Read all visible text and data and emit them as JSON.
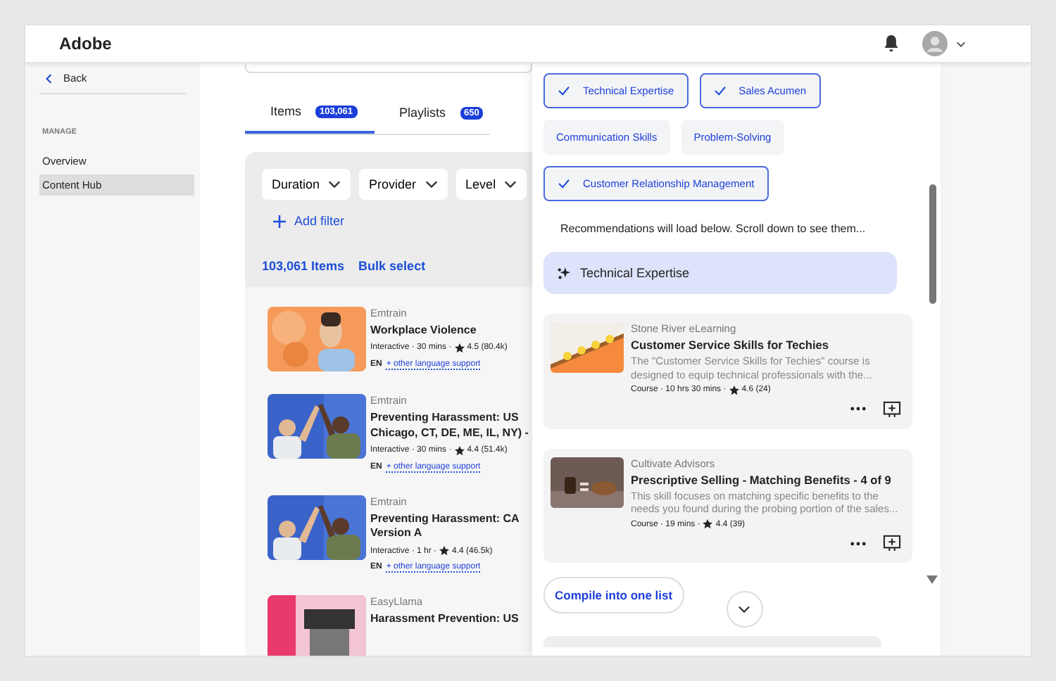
{
  "header": {
    "logo": "Adobe"
  },
  "sidebar": {
    "back": "Back",
    "section": "MANAGE",
    "items": [
      {
        "label": "Overview",
        "selected": false
      },
      {
        "label": "Content Hub",
        "selected": true
      }
    ]
  },
  "tabs": [
    {
      "label": "Items",
      "count": "103,061",
      "selected": true
    },
    {
      "label": "Playlists",
      "count": "650",
      "selected": false
    }
  ],
  "filters": [
    "Duration",
    "Provider",
    "Level"
  ],
  "add_filter": "Add filter",
  "item_count": "103,061 Items",
  "bulk_select": "Bulk select",
  "items": [
    {
      "provider": "Emtrain",
      "title": "Workplace Violence",
      "meta": "Interactive · 30 mins ·",
      "rating": "4.5 (80.4k)",
      "lang": "EN",
      "lang_link": "+ other language support"
    },
    {
      "provider": "Emtrain",
      "title": "Preventing Harassment: US Chicago, CT, DE, ME, IL, NY) -",
      "meta": "Interactive · 30 mins ·",
      "rating": "4.4 (51.4k)",
      "lang": "EN",
      "lang_link": "+ other language support"
    },
    {
      "provider": "Emtrain",
      "title": "Preventing Harassment: CA Version A",
      "meta": "Interactive · 1 hr ·",
      "rating": "4.4 (46.5k)",
      "lang": "EN",
      "lang_link": "+ other language support"
    },
    {
      "provider": "EasyLlama",
      "title": "Harassment Prevention: US"
    }
  ],
  "panel": {
    "skills": [
      {
        "label": "Technical Expertise",
        "selected": true
      },
      {
        "label": "Sales Acumen",
        "selected": true
      },
      {
        "label": "Communication Skills",
        "selected": false
      },
      {
        "label": "Problem-Solving",
        "selected": false
      },
      {
        "label": "Customer Relationship Management",
        "selected": true
      }
    ],
    "notice": "Recommendations will load below. Scroll down to see them...",
    "section": "Technical Expertise",
    "courses": [
      {
        "provider": "Stone River eLearning",
        "title": "Customer Service Skills for Techies",
        "description": "The \"Customer Service Skills for Techies\" course is designed to equip technical professionals with the...",
        "meta": "Course · 10 hrs 30 mins ·",
        "rating": "4.6 (24)"
      },
      {
        "provider": "Cultivate Advisors",
        "title": "Prescriptive Selling - Matching Benefits - 4 of 9",
        "description": "This skill focuses on matching specific benefits to the needs you found during the probing portion of the sales...",
        "meta": "Course · 19 mins ·",
        "rating": "4.4 (39)"
      }
    ],
    "compile": "Compile into one list"
  }
}
